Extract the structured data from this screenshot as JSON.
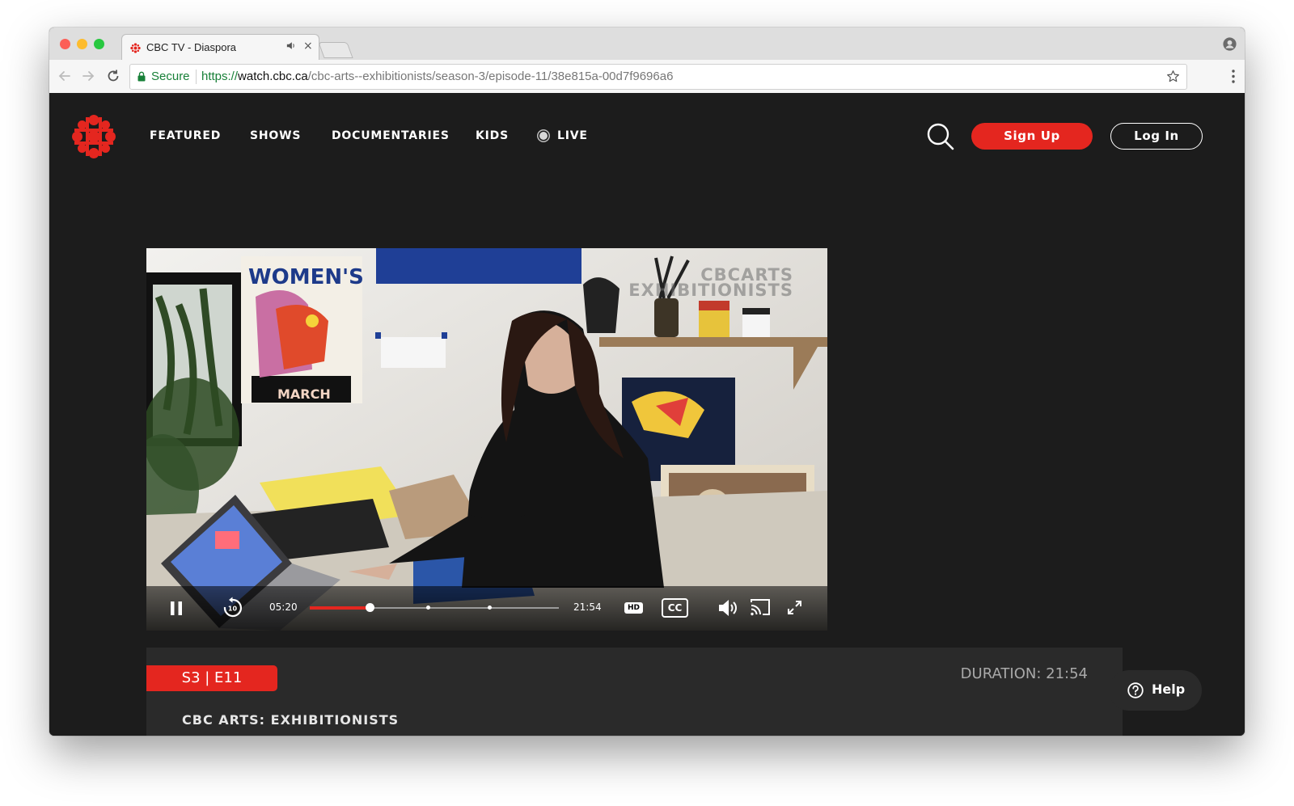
{
  "browser": {
    "tab_title": "CBC TV - Diaspora",
    "tab_audio_icon": "speaker-icon",
    "tab_close_glyph": "×",
    "secure_label": "Secure",
    "url_scheme": "https://",
    "url_host": "watch.cbc.ca",
    "url_path": "/cbc-arts--exhibitionists/season-3/episode-11/38e815a-00d7f9696a6"
  },
  "site": {
    "nav": {
      "featured": "FEATURED",
      "shows": "SHOWS",
      "documentaries": "DOCUMENTARIES",
      "kids": "KIDS",
      "live": "LIVE"
    },
    "signup_label": "Sign Up",
    "login_label": "Log In",
    "brand_color": "#e4261f"
  },
  "player": {
    "watermark_line1": "CBCARTS",
    "watermark_line2": "EXHIBITIONISTS",
    "poster_word": "WOMEN'S",
    "poster_sub": "MARCH",
    "time_current": "05:20",
    "time_total": "21:54",
    "progress_fraction": 0.243,
    "chapter_markers": [
      0.476,
      0.722
    ],
    "hd_label": "HD",
    "cc_label": "CC",
    "rewind_seconds": "10"
  },
  "episode": {
    "season_episode": "S3 | E11",
    "duration_label": "DURATION: 21:54",
    "series_title": "CBC ARTS: EXHIBITIONISTS"
  },
  "help": {
    "label": "Help"
  }
}
